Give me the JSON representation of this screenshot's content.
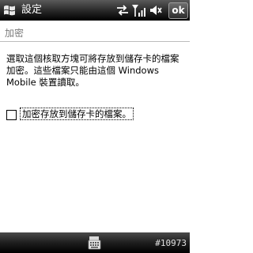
{
  "titlebar": {
    "title": "設定",
    "icons": [
      "windows-flag-icon",
      "connectivity-icon",
      "signal-icon",
      "volume-icon"
    ],
    "ok_label": "ok"
  },
  "page": {
    "title": "加密",
    "description": "選取這個核取方塊可將存放到儲存卡的檔案加密。這些檔案只能由這個 Windows Mobile 裝置讀取。",
    "checkbox": {
      "label": "加密存放到儲存卡的檔案。",
      "checked": false
    }
  },
  "bottombar": {
    "icon": "keyboard-icon",
    "screen_id": "#10973"
  },
  "colors": {
    "titlebar_bg": "#1a1a1a",
    "page_title": "#7a7a7a",
    "rule": "#bdbdbd"
  }
}
